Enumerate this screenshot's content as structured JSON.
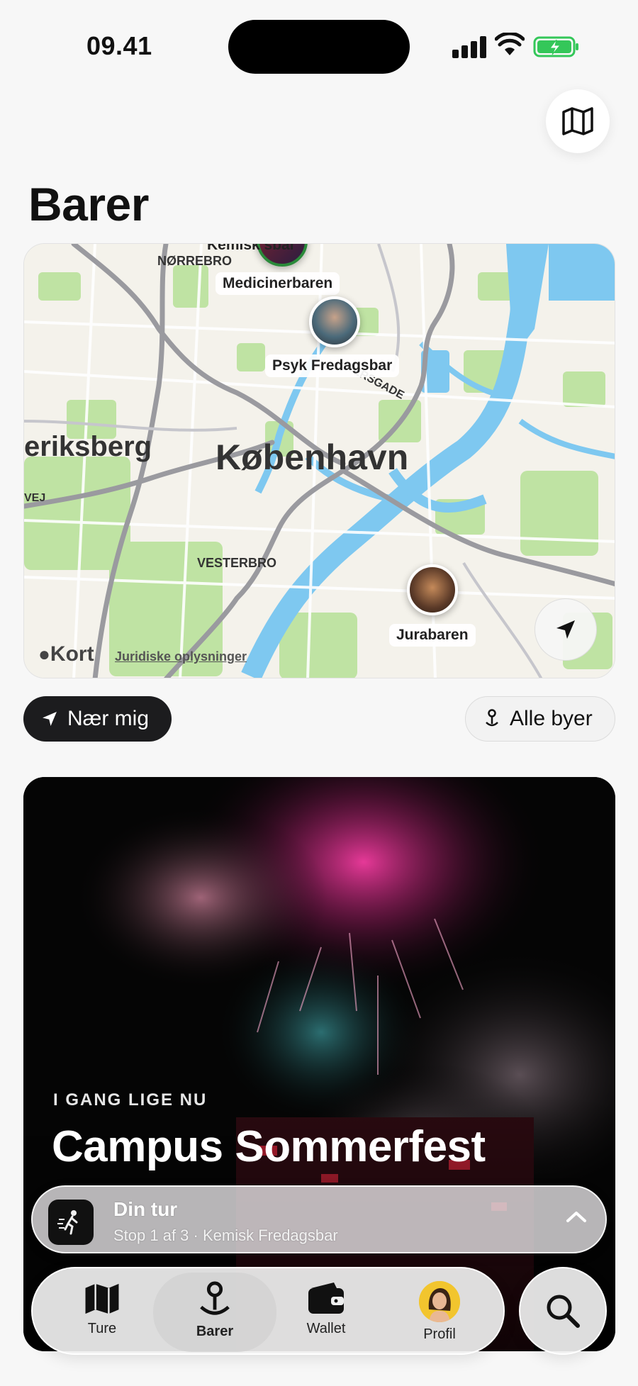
{
  "status_bar": {
    "time": "09.41"
  },
  "header": {
    "title": "Barer",
    "map_toggle_icon": "map-icon"
  },
  "map": {
    "district_labels": [
      "NØRREBRO",
      "VESTERBRO",
      "ERSGADE",
      "VEJ"
    ],
    "city_label": "København",
    "area_label": "eriksberg",
    "pins": [
      {
        "name": "Kemisk Fredagsbar",
        "visible_text": "Kemisk    sbar"
      },
      {
        "name": "Medicinerbaren"
      },
      {
        "name": "Psyk Fredagsbar"
      },
      {
        "name": "Jurabaren"
      }
    ],
    "attribution": "Kort",
    "legal": "Juridiske oplysninger",
    "locate_icon": "location-arrow-icon"
  },
  "filters": {
    "near_me": "Nær mig",
    "all_cities": "Alle byer"
  },
  "event": {
    "eyebrow": "I GANG LIGE NU",
    "title": "Campus Sommerfest"
  },
  "trip": {
    "title": "Din tur",
    "subtitle": "Stop 1 af 3 · Kemisk Fredagsbar"
  },
  "tabs": [
    {
      "label": "Ture",
      "icon": "map-icon"
    },
    {
      "label": "Barer",
      "icon": "pin-icon",
      "active": true
    },
    {
      "label": "Wallet",
      "icon": "wallet-icon"
    },
    {
      "label": "Profil",
      "icon": "avatar"
    }
  ],
  "colors": {
    "water": "#7ec8f0",
    "park": "#bfe3a3",
    "road": "#8e8e93",
    "accent_dark": "#1c1c1e",
    "battery": "#34c759"
  }
}
